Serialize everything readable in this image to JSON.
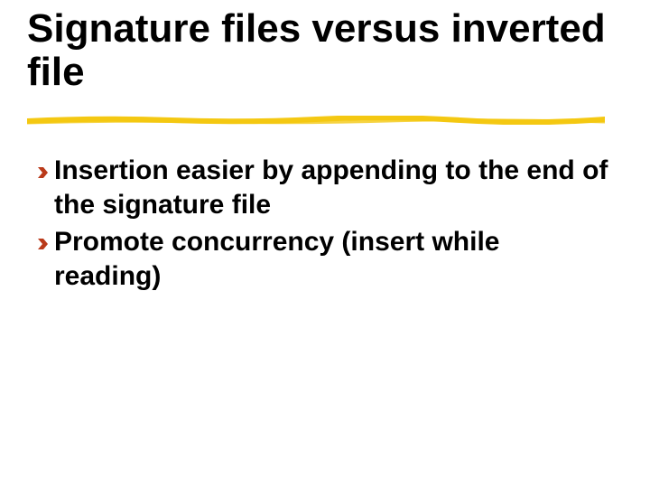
{
  "title": "Signature files versus inverted file",
  "bullets": [
    "Insertion easier by appending to the end of the signature file",
    "Promote concurrency (insert while reading)"
  ],
  "colors": {
    "underline": "#f4c812",
    "bullet": "#ba3a1a"
  }
}
